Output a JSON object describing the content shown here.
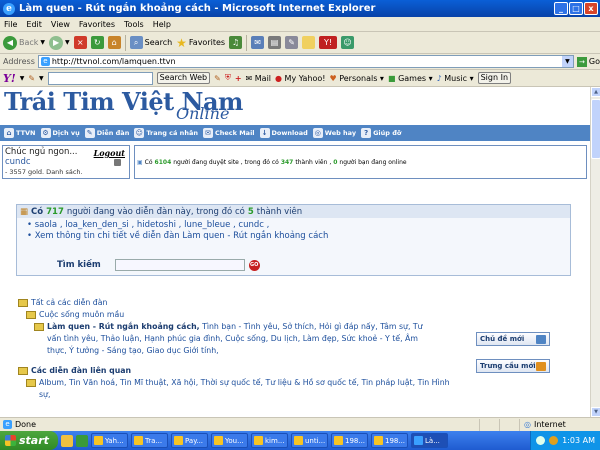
{
  "window": {
    "title": "Làm quen - Rút ngắn khoảng cách - Microsoft Internet Explorer",
    "controls": [
      "_",
      "□",
      "x"
    ]
  },
  "menu": [
    "File",
    "Edit",
    "View",
    "Favorites",
    "Tools",
    "Help"
  ],
  "toolbar": {
    "back": "Back",
    "search": "Search",
    "favorites": "Favorites"
  },
  "address": {
    "label": "Address",
    "url": "http://ttvnol.com/lamquen.ttvn",
    "go": "Go"
  },
  "yahoo": {
    "logo": "Y!",
    "search_web": "Search Web",
    "mail": "Mail",
    "my_yahoo": "My Yahoo!",
    "personals": "Personals",
    "games": "Games",
    "music": "Music",
    "sign_in": "Sign In"
  },
  "site": {
    "logo_main": "Trái Tim Việt Nam",
    "logo_sub": "Online",
    "nav": [
      "TTVN",
      "Dịch vụ",
      "Diễn đàn",
      "Trang cá nhân",
      "Check Mail",
      "Download",
      "Web hay",
      "Giúp đỡ"
    ]
  },
  "login": {
    "greeting": "Chúc ngủ ngon...",
    "username": "cundc",
    "gold": "- 3557 gold. Danh sách.",
    "logout": "Logout"
  },
  "online": {
    "prefix": "Có",
    "browsing": "6104",
    "text1": "người đang duyệt site , trong đó có",
    "members": "347",
    "text2": "thành viên ,",
    "friends": "0",
    "text3": "người bạn đang online"
  },
  "forum": {
    "head_prefix": "Có",
    "count": "717",
    "head_mid": "người đang vào diễn đàn này, trong đó có",
    "members": "5",
    "head_suffix": "thành viên",
    "users": "saola , loa_ken_den_si , hidetoshi , lune_bleue , cundc ,",
    "details": "Xem thông tin chi tiết về diễn đàn Làm quen - Rút ngắn khoảng cách",
    "search_label": "Tìm kiếm",
    "search_go": "GO"
  },
  "tree": {
    "all": "Tất cả các diễn đàn",
    "life": "Cuộc sống muôn mầu",
    "current": "Làm quen - Rút ngắn khoảng cách,",
    "subs": "Tình bạn - Tình yêu, Sở thích, Hỏi gì đáp nấy, Tâm sự, Tư vấn tình yêu, Thảo luận, Hạnh phúc gia đình, Cuộc sống, Du lịch, Làm đẹp, Sức khoẻ - Y tế, Âm thực, Ý tưởng - Sáng tạo, Giao dục Giới tính,",
    "related": "Các diễn đàn liên quan",
    "related_subs": "Album, Tin Văn hoá, Tin Mĩ thuật, Xã hội, Thời sự quốc tế, Tư liệu & Hồ sơ quốc tế, Tin pháp luật, Tin Hình sự,"
  },
  "buttons": {
    "new_topic": "Chủ đề mới",
    "new_poll": "Trưng cầu mới"
  },
  "status": {
    "text": "Done",
    "zone": "Internet"
  },
  "taskbar": {
    "start": "start",
    "tasks": [
      "Yah...",
      "Tra...",
      "Pay...",
      "You...",
      "kim...",
      "unti...",
      "198...",
      "198...",
      "Là..."
    ],
    "time": "1:03 AM"
  },
  "colors": {
    "title_bar": "#0a5fd6",
    "site_nav": "#4f84c4",
    "highlight_number": "#2a9a2a",
    "link": "#1c4e9c"
  }
}
